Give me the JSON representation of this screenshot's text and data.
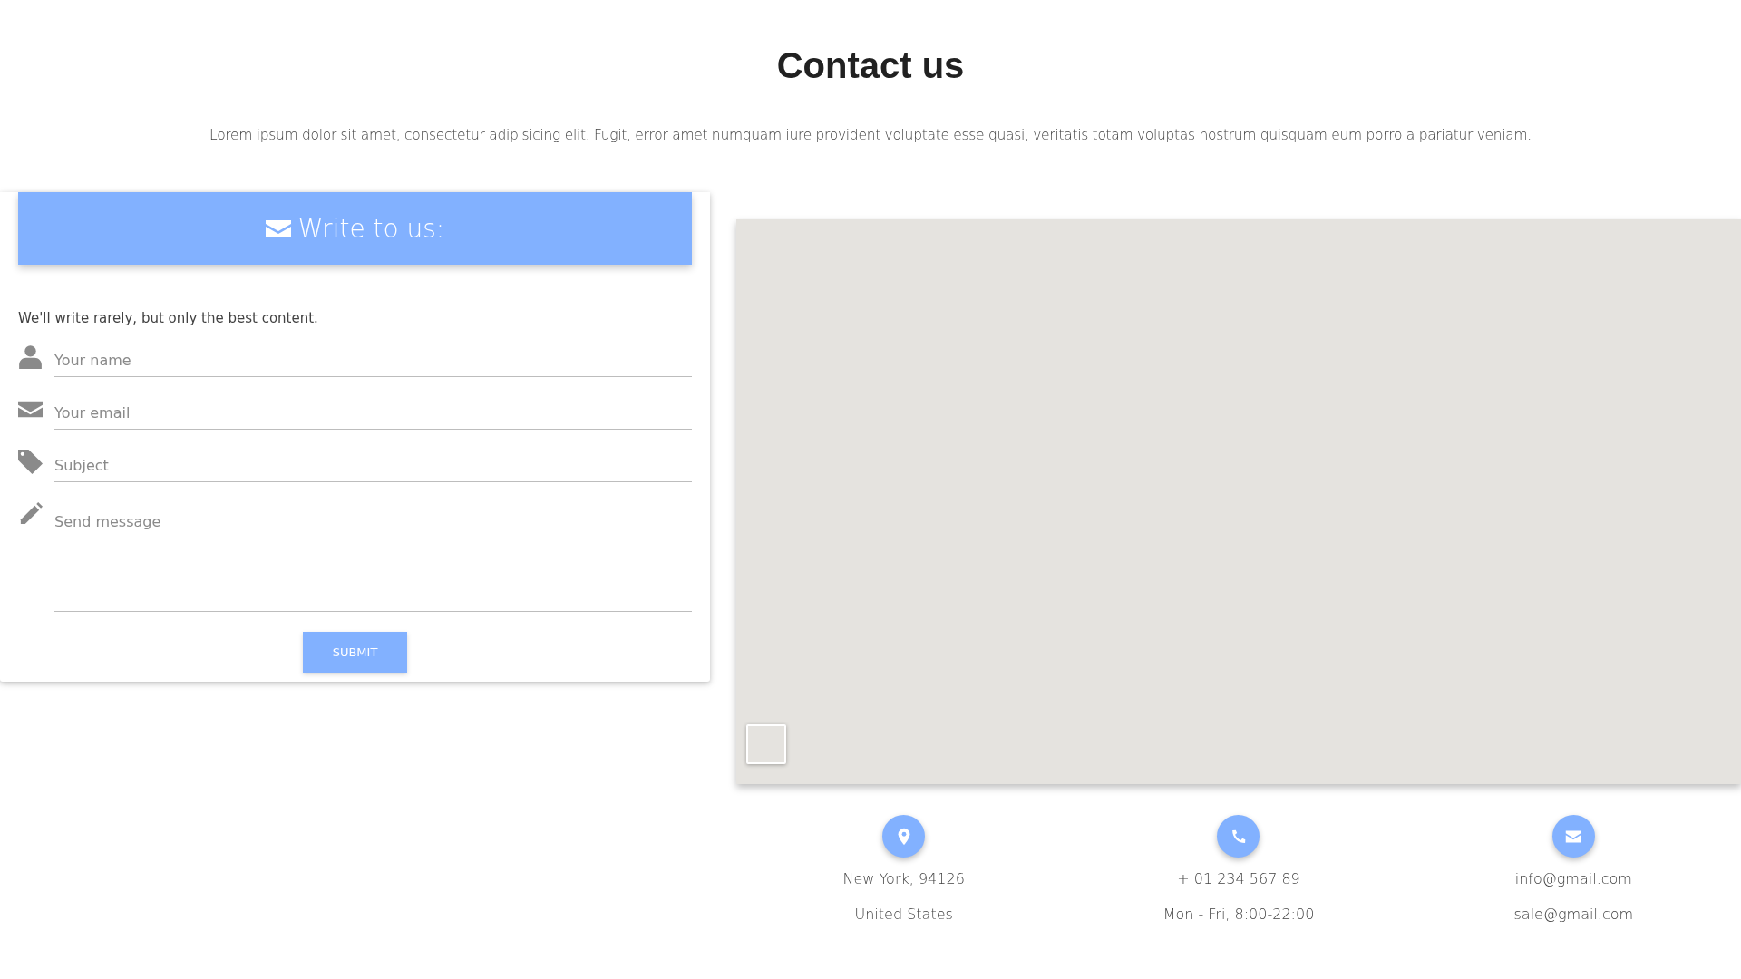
{
  "title": "Contact us",
  "intro": "Lorem ipsum dolor sit amet, consectetur adipisicing elit. Fugit, error amet numquam iure provident voluptate esse quasi, veritatis totam voluptas nostrum quisquam eum porro a pariatur veniam.",
  "form": {
    "header": "Write to us:",
    "note": "We'll write rarely, but only the best content.",
    "fields": [
      {
        "kind": "name",
        "placeholder": "Your name"
      },
      {
        "kind": "email",
        "placeholder": "Your email"
      },
      {
        "kind": "subject",
        "placeholder": "Subject"
      },
      {
        "kind": "message",
        "placeholder": "Send message"
      }
    ],
    "submit": "SUBMIT"
  },
  "contacts": [
    {
      "kind": "location",
      "lines": [
        "New York, 94126",
        "United States"
      ]
    },
    {
      "kind": "phone",
      "lines": [
        "+ 01 234 567 89",
        "Mon - Fri, 8:00-22:00"
      ]
    },
    {
      "kind": "email",
      "lines": [
        "info@gmail.com",
        "sale@gmail.com"
      ]
    }
  ]
}
